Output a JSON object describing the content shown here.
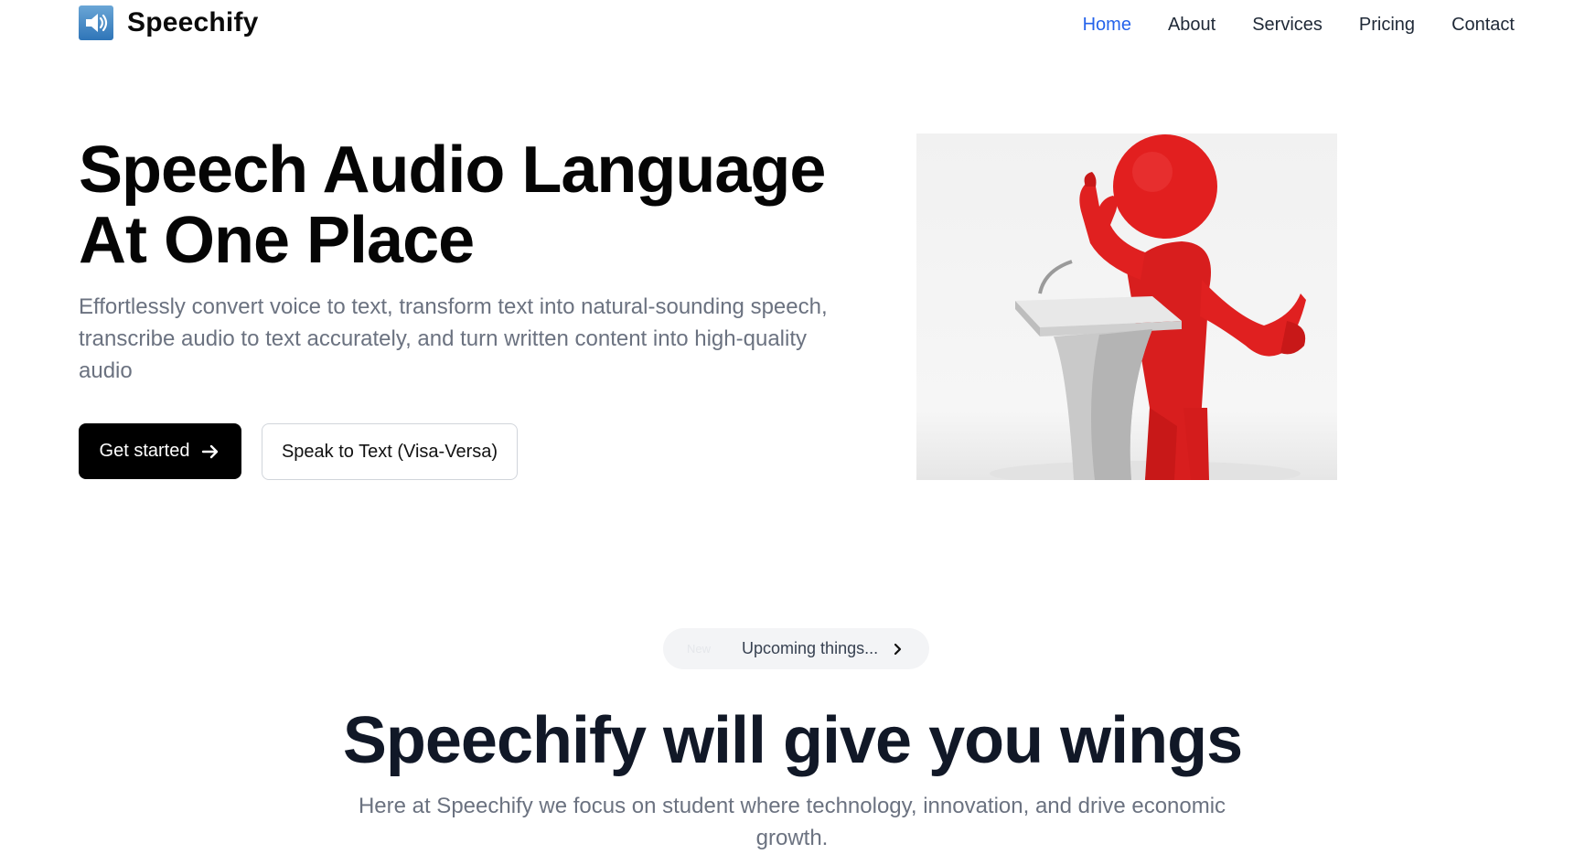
{
  "brand": {
    "name": "Speechify",
    "logo_icon": "speaker-icon",
    "logo_color": "#2f75b8"
  },
  "nav": {
    "items": [
      {
        "label": "Home",
        "active": true
      },
      {
        "label": "About",
        "active": false
      },
      {
        "label": "Services",
        "active": false
      },
      {
        "label": "Pricing",
        "active": false
      },
      {
        "label": "Contact",
        "active": false
      }
    ],
    "active_color": "#2563eb"
  },
  "hero": {
    "title_line1": "Speech Audio Language",
    "title_line2": "At One Place",
    "subtitle": "Effortlessly convert voice to text, transform text into natural-sounding speech, transcribe audio to text accurately, and turn written content into high-quality audio",
    "primary_button": "Get started",
    "primary_button_icon": "arrow-right-icon",
    "secondary_button": "Speak to Text (Visa-Versa)",
    "image_description_icon": "speaker-at-podium-illustration"
  },
  "announcement": {
    "badge": "New",
    "text": "Upcoming things...",
    "icon": "chevron-right-icon"
  },
  "section": {
    "title": "Speechify will give you wings",
    "subtitle": "Here at Speechify we focus on student where technology, innovation, and drive economic growth."
  }
}
